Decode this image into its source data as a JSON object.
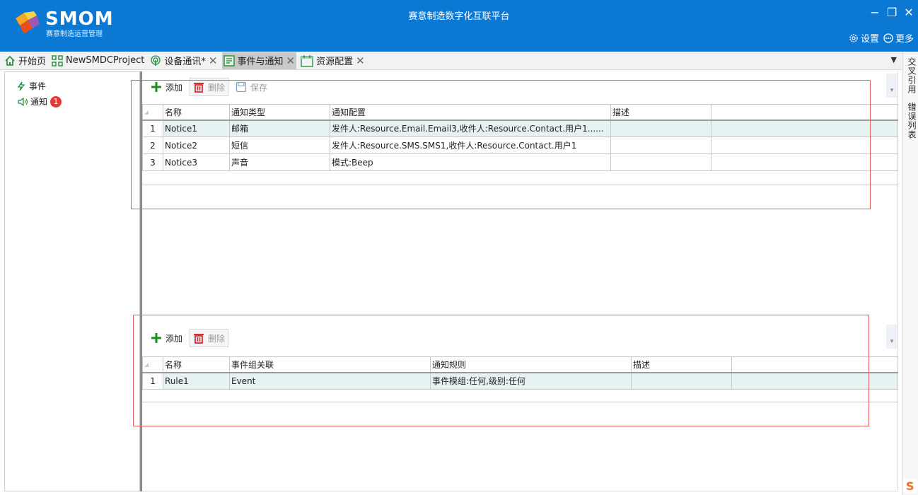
{
  "app": {
    "logo_text": "SMOM",
    "logo_subtitle": "赛意制造运营管理",
    "title": "赛意制造数字化互联平台"
  },
  "window_controls": {
    "minimize": "−",
    "maximize": "❐",
    "close": "✕"
  },
  "top_links": {
    "settings": "设置",
    "more": "更多"
  },
  "tabs": [
    {
      "label": "开始页",
      "icon": "home-icon",
      "closable": false
    },
    {
      "label": "NewSMDCProject",
      "icon": "project-icon",
      "closable": false
    },
    {
      "label": "设备通讯*",
      "icon": "signal-icon",
      "closable": true
    },
    {
      "label": "事件与通知",
      "icon": "event-notice-icon",
      "closable": true,
      "active": true
    },
    {
      "label": "资源配置",
      "icon": "calendar-icon",
      "closable": true
    }
  ],
  "tab_menu": "▼",
  "right_strip": {
    "cross_ref": "交叉引用",
    "error_list": "错误列表"
  },
  "tree": {
    "event": {
      "label": "事件",
      "icon": "lightning-icon"
    },
    "notice": {
      "label": "通知",
      "icon": "speaker-icon",
      "badge": "1"
    }
  },
  "notice_panel": {
    "toolbar": {
      "add": "添加",
      "delete": "删除",
      "save": "保存"
    },
    "columns": [
      "名称",
      "通知类型",
      "通知配置",
      "描述"
    ],
    "rows": [
      {
        "no": "1",
        "name": "Notice1",
        "type": "邮箱",
        "config": "发件人:Resource.Email.Email3,收件人:Resource.Contact.用户1......",
        "desc": ""
      },
      {
        "no": "2",
        "name": "Notice2",
        "type": "短信",
        "config": "发件人:Resource.SMS.SMS1,收件人:Resource.Contact.用户1",
        "desc": ""
      },
      {
        "no": "3",
        "name": "Notice3",
        "type": "声音",
        "config": "模式:Beep",
        "desc": ""
      }
    ]
  },
  "rule_panel": {
    "toolbar": {
      "add": "添加",
      "delete": "删除"
    },
    "columns": [
      "名称",
      "事件组关联",
      "通知规则",
      "描述"
    ],
    "rows": [
      {
        "no": "1",
        "name": "Rule1",
        "event_group": "Event",
        "rule": "事件模组:任何,级别:任何",
        "desc": ""
      }
    ]
  },
  "colors": {
    "title_bar": "#0b78d4",
    "add_green": "#1e8e1e",
    "delete_red": "#d32f2f",
    "highlight_box": "#e06060",
    "selected_row": "#e6f2f2"
  }
}
